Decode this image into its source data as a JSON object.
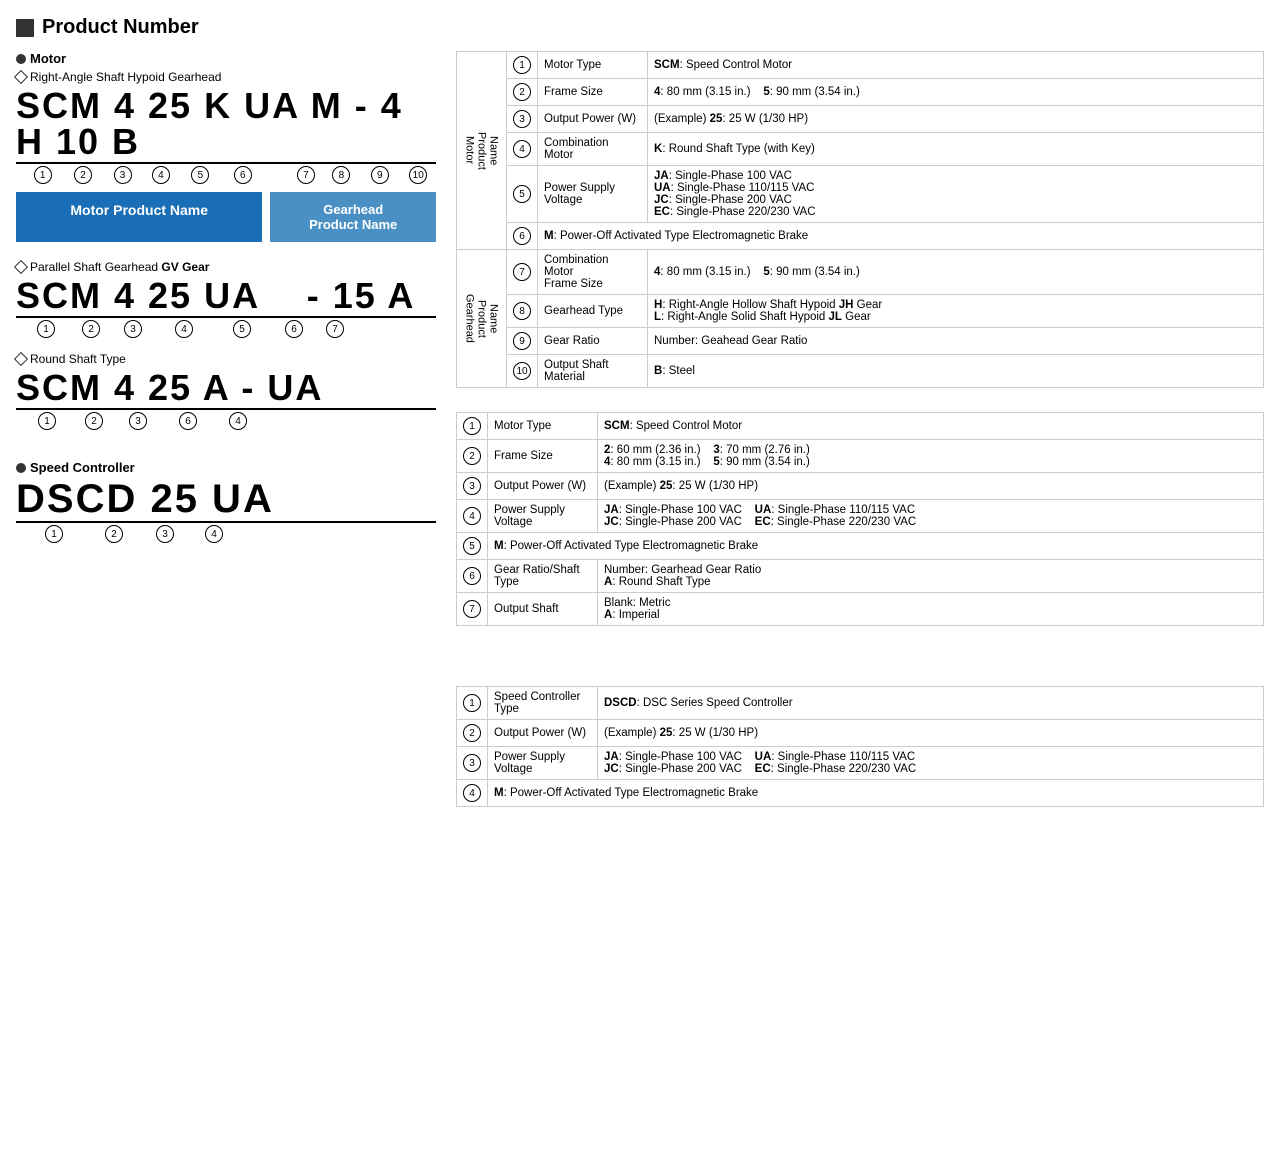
{
  "page": {
    "title": "Product Number"
  },
  "motor_section": {
    "bullet": "Motor",
    "subsections": [
      {
        "id": "hypoid",
        "diamond_label": "Right-Angle Shaft Hypoid Gearhead",
        "code_parts": [
          "SCM",
          "4",
          "25",
          "K",
          "UA",
          "M",
          "-",
          "4",
          "H",
          "10",
          "B"
        ],
        "code_display": "SCM 4 25 K UA M - 4 H 10 B",
        "numbers": [
          "①",
          "②",
          "③",
          "④",
          "⑤",
          "⑥",
          "",
          "⑦",
          "⑧",
          "⑨",
          "⑩"
        ],
        "motor_label": "Motor Product Name",
        "gearhead_label": "Gearhead\nProduct Name"
      },
      {
        "id": "parallel",
        "diamond_label": "Parallel Shaft Gearhead GV Gear",
        "diamond_bold": "GV Gear",
        "code_display": "SCM 4 25 UA    - 15 A",
        "numbers_display": "① ② ③ ④ ⑤  ⑥ ⑦"
      },
      {
        "id": "round",
        "diamond_label": "Round Shaft Type",
        "code_display": "SCM 4 25 A - UA",
        "numbers_display": "① ② ③ ⑥   ④"
      }
    ]
  },
  "speed_controller": {
    "bullet": "Speed Controller",
    "code_display": "DSCD 25 UA",
    "numbers_display": "① ② ③ ④"
  },
  "table_hypoid": {
    "rows": [
      {
        "group": "Motor\nProduct\nName",
        "num": "①",
        "field": "Motor Type",
        "value": "SCM: Speed Control Motor",
        "value_bold_part": "SCM"
      },
      {
        "group": "",
        "num": "②",
        "field": "Frame Size",
        "value": "4: 80 mm (3.15 in.)    5: 90 mm (3.54 in.)",
        "bold_parts": [
          "4",
          "5"
        ]
      },
      {
        "group": "",
        "num": "③",
        "field": "Output Power (W)",
        "value": "(Example) 25: 25 W (1/30 HP)",
        "bold_parts": [
          "25"
        ]
      },
      {
        "group": "",
        "num": "④",
        "field": "Combination Motor",
        "value": "K: Round Shaft Type (with Key)",
        "bold_parts": [
          "K"
        ]
      },
      {
        "group": "",
        "num": "⑤",
        "field": "Power Supply Voltage",
        "value": "JA: Single-Phase 100 VAC\nUA: Single-Phase 110/115 VAC\nJC: Single-Phase 200 VAC\nEC: Single-Phase 220/230 VAC",
        "bold_parts": [
          "JA",
          "UA",
          "JC",
          "EC"
        ]
      },
      {
        "group": "",
        "num": "⑥",
        "field": "",
        "value": "M: Power-Off Activated Type Electromagnetic Brake",
        "bold_parts": [
          "M"
        ],
        "colspan": true
      },
      {
        "group": "Gearhead\nProduct\nName",
        "num": "⑦",
        "field": "Combination Motor\nFrame Size",
        "value": "4: 80 mm (3.15 in.)    5: 90 mm (3.54 in.)",
        "bold_parts": [
          "4",
          "5"
        ]
      },
      {
        "group": "",
        "num": "⑧",
        "field": "Gearhead Type",
        "value": "H: Right-Angle Hollow Shaft Hypoid JH Gear\nL: Right-Angle Solid Shaft Hypoid JL Gear",
        "bold_parts": [
          "H",
          "JH",
          "L",
          "JL"
        ]
      },
      {
        "group": "",
        "num": "⑨",
        "field": "Gear Ratio",
        "value": "Number: Geahead Gear Ratio"
      },
      {
        "group": "",
        "num": "⑩",
        "field": "Output Shaft Material",
        "value": "B: Steel",
        "bold_parts": [
          "B"
        ]
      }
    ]
  },
  "table_parallel": {
    "rows": [
      {
        "num": "①",
        "field": "Motor Type",
        "value": "SCM: Speed Control Motor",
        "bold_parts": [
          "SCM"
        ]
      },
      {
        "num": "②",
        "field": "Frame Size",
        "value": "2: 60 mm (2.36 in.)    3: 70 mm (2.76 in.)\n4: 80 mm (3.15 in.)    5: 90 mm (3.54 in.)",
        "bold_parts": [
          "2",
          "3",
          "4",
          "5"
        ]
      },
      {
        "num": "③",
        "field": "Output Power (W)",
        "value": "(Example) 25: 25 W (1/30 HP)",
        "bold_parts": [
          "25"
        ]
      },
      {
        "num": "④",
        "field": "Power Supply Voltage",
        "value": "JA: Single-Phase 100 VAC    UA: Single-Phase 110/115 VAC\nJC: Single-Phase 200 VAC    EC: Single-Phase 220/230 VAC",
        "bold_parts": [
          "JA",
          "UA",
          "JC",
          "EC"
        ]
      },
      {
        "num": "⑤",
        "field": "",
        "value": "M: Power-Off Activated Type Electromagnetic Brake",
        "bold_parts": [
          "M"
        ],
        "colspan": true
      },
      {
        "num": "⑥",
        "field": "Gear Ratio/Shaft\nType",
        "value": "Number: Gearhead Gear Ratio\nA: Round Shaft Type",
        "bold_parts": [
          "A"
        ]
      },
      {
        "num": "⑦",
        "field": "Output Shaft",
        "value": "Blank: Metric\nA: Imperial",
        "bold_parts": [
          "A"
        ]
      }
    ]
  },
  "table_speed_controller": {
    "rows": [
      {
        "num": "①",
        "field": "Speed Controller\nType",
        "value": "DSCD: DSC Series Speed Controller",
        "bold_parts": [
          "DSCD"
        ]
      },
      {
        "num": "②",
        "field": "Output Power (W)",
        "value": "(Example) 25: 25 W (1/30 HP)",
        "bold_parts": [
          "25"
        ]
      },
      {
        "num": "③",
        "field": "Power Supply Voltage",
        "value": "JA: Single-Phase 100 VAC    UA: Single-Phase 110/115 VAC\nJC: Single-Phase 200 VAC    EC: Single-Phase 220/230 VAC",
        "bold_parts": [
          "JA",
          "UA",
          "JC",
          "EC"
        ]
      },
      {
        "num": "④",
        "field": "",
        "value": "M: Power-Off Activated Type Electromagnetic Brake",
        "bold_parts": [
          "M"
        ],
        "colspan": true
      }
    ]
  }
}
